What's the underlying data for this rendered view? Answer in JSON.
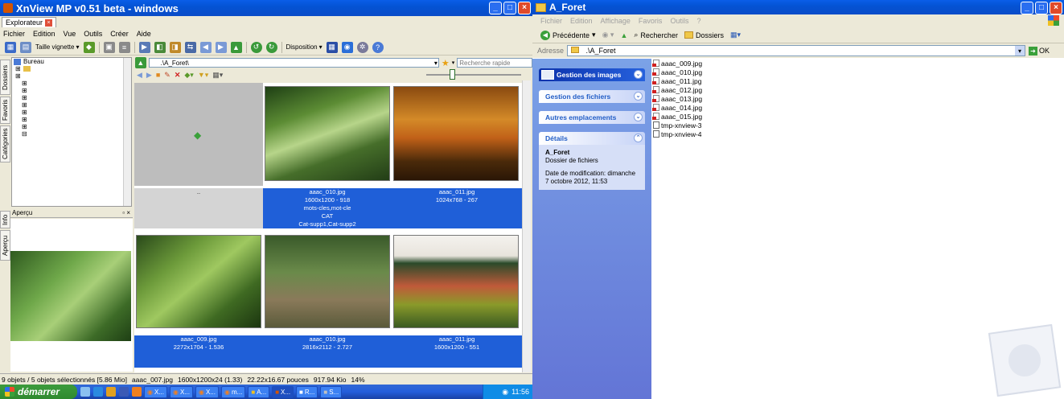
{
  "xnview": {
    "title": "XnView MP v0.51 beta - windows",
    "tab_label": "Explorateur",
    "menu": [
      "Fichier",
      "Edition",
      "Vue",
      "Outils",
      "Créer",
      "Aide"
    ],
    "toolbar": {
      "thumb_size_label": "Taille vignette",
      "layout_label": "Disposition"
    },
    "side_tabs": [
      "Dossiers",
      "Favoris",
      "Catégories"
    ],
    "side_tabs_bottom": [
      "Info",
      "Aperçu"
    ],
    "tree_root": "Bureau",
    "preview_title": "Aperçu",
    "address_value": ".\\A_Foret\\",
    "search_placeholder": "Recherche rapide",
    "parent_label": "..",
    "row1": [
      {
        "name": "aaac_010.jpg",
        "dims": "1600x1200 - 918",
        "keywords": "mots-cles,mot-cle",
        "category": "CAT",
        "subcats": "Cat-supp1,Cat-supp2"
      },
      {
        "name": "aaac_011.jpg",
        "dims": "1024x768 - 267"
      }
    ],
    "row2": [
      {
        "name": "aaac_009.jpg",
        "dims": "2272x1704 - 1.536"
      },
      {
        "name": "aaac_010.jpg",
        "dims": "2816x2112 - 2.727"
      },
      {
        "name": "aaac_011.jpg",
        "dims": "1600x1200 - 551"
      }
    ],
    "status": {
      "selection": "9 objets / 5 objets sélectionnés [5.86 Mio]",
      "file": "aaac_007.jpg",
      "resolution": "1600x1200x24 (1.33)",
      "print_size": "22.22x16.67 pouces",
      "file_size": "917.94 Kio",
      "zoom": "14%"
    }
  },
  "taskbar": {
    "start_label": "démarrer",
    "tasks": [
      "X...",
      "X...",
      "X...",
      "m...",
      "A...",
      "X...",
      "R...",
      "S..."
    ],
    "clock": "11:56"
  },
  "explorer": {
    "title": "A_Foret",
    "menu": [
      "Fichier",
      "Edition",
      "Affichage",
      "Favoris",
      "Outils",
      "?"
    ],
    "toolbar": {
      "back_label": "Précédente",
      "search_label": "Rechercher",
      "folders_label": "Dossiers"
    },
    "address_label": "Adresse",
    "address_value": ".\\A_Foret",
    "go_label": "OK",
    "panels": {
      "images": "Gestion des images",
      "files": "Gestion des fichiers",
      "places": "Autres emplacements",
      "details": "Détails"
    },
    "details": {
      "name": "A_Foret",
      "type": "Dossier de fichiers",
      "modified": "Date de modification: dimanche 7 octobre 2012, 11:53"
    },
    "files": [
      "aaac_009.jpg",
      "aaac_010.jpg",
      "aaac_011.jpg",
      "aaac_012.jpg",
      "aaac_013.jpg",
      "aaac_014.jpg",
      "aaac_015.jpg",
      "tmp-xnview-3",
      "tmp-xnview-4"
    ]
  },
  "colors": {
    "xp_blue": "#0453d4",
    "selection_blue": "#1f5fd8",
    "start_green": "#2f8a2f",
    "task_pane": "#6d8ddf"
  }
}
